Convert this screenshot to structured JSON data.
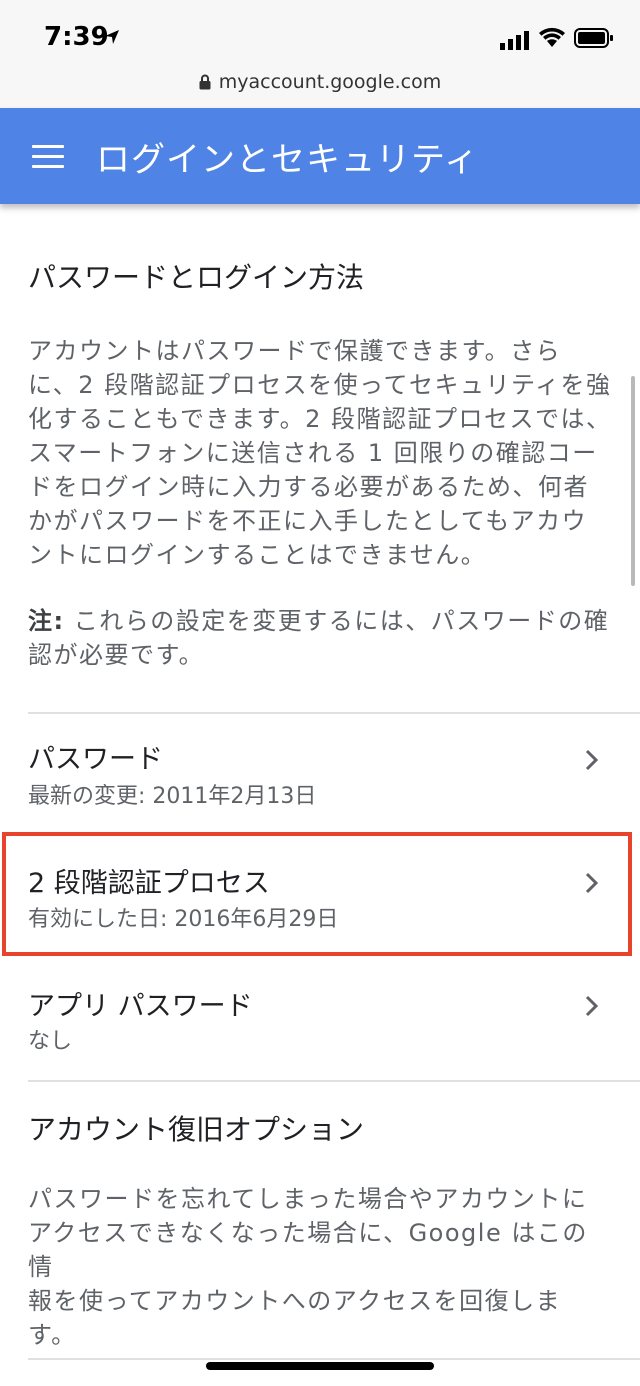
{
  "status_bar": {
    "time": "7:39",
    "url": "myaccount.google.com"
  },
  "app_bar": {
    "title": "ログインとセキュリティ"
  },
  "password_section": {
    "title": "パスワードとログイン方法",
    "description_lines": [
      "アカウントはパスワードで保護できます。さら",
      "に、2 段階認証プロセスを使ってセキュリティを強",
      "化することもできます。2 段階認証プロセスでは、",
      "スマートフォンに送信される 1 回限りの確認コー",
      "ドをログイン時に入力する必要があるため、何者",
      "かがパスワードを不正に入手したとしてもアカウ",
      "ントにログインすることはできません。"
    ],
    "note_label": "注:",
    "note_line1": " これらの設定を変更するには、パスワードの確",
    "note_line2": "認が必要です。"
  },
  "rows": [
    {
      "title": "パスワード",
      "subtitle": "最新の変更: 2011年2月13日"
    },
    {
      "title": "2 段階認証プロセス",
      "subtitle": "有効にした日: 2016年6月29日"
    },
    {
      "title": "アプリ パスワード",
      "subtitle": "なし"
    }
  ],
  "recovery_section": {
    "title": "アカウント復旧オプション",
    "description_lines": [
      "パスワードを忘れてしまった場合やアカウントに",
      "アクセスできなくなった場合に、Google はこの情",
      "報を使ってアカウントへのアクセスを回復しま",
      "す。"
    ]
  },
  "colors": {
    "app_bar": "#4f84e6",
    "highlight": "#e8432c"
  }
}
